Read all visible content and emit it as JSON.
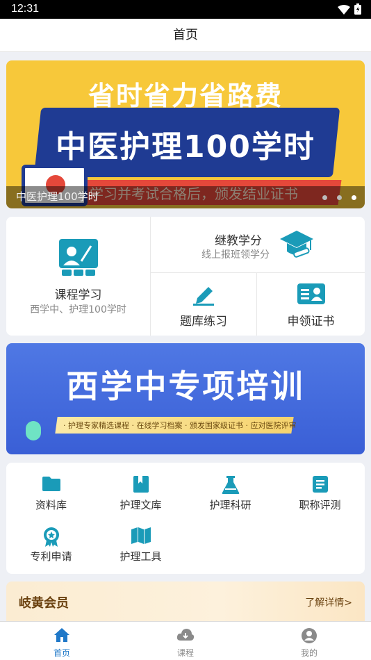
{
  "status_bar": {
    "time": "12:31"
  },
  "header": {
    "title": "首页"
  },
  "banner_top": {
    "slogan": "省时省力省路费",
    "main_text": "中医护理100学时",
    "sub_text": "学习并考试合格后，颁发结业证书",
    "caption": "中医护理100学时",
    "active_dot": 3
  },
  "feature_grid": {
    "course": {
      "title": "课程学习",
      "subtitle": "西学中、护理100学时"
    },
    "credit": {
      "title": "继教学分",
      "subtitle": "线上报班领学分"
    },
    "quiz": {
      "title": "题库练习"
    },
    "certificate": {
      "title": "申领证书"
    }
  },
  "banner_mid": {
    "title": "西学中专项培训",
    "subtitle": "· 护理专家精选课程 · 在线学习档案 · 颁发国家级证书 · 应对医院评审"
  },
  "tools": [
    {
      "label": "资料库",
      "icon": "folder-icon"
    },
    {
      "label": "护理文库",
      "icon": "book-icon"
    },
    {
      "label": "护理科研",
      "icon": "flask-icon"
    },
    {
      "label": "职称评测",
      "icon": "notebook-icon"
    },
    {
      "label": "专利申请",
      "icon": "badge-icon"
    },
    {
      "label": "护理工具",
      "icon": "map-icon"
    }
  ],
  "member": {
    "title": "岐黄会员",
    "link": "了解详情>"
  },
  "tabbar": [
    {
      "label": "首页",
      "icon": "home-icon",
      "active": true
    },
    {
      "label": "课程",
      "icon": "cloud-icon",
      "active": false
    },
    {
      "label": "我的",
      "icon": "profile-icon",
      "active": false
    }
  ],
  "colors": {
    "accent": "#1f78c8",
    "teal": "#1a9bb8",
    "banner_yellow": "#f7c83a",
    "banner_blue": "#3a5fd6"
  }
}
